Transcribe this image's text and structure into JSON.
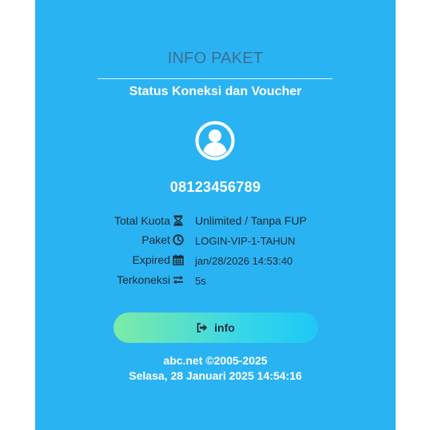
{
  "header": {
    "title": "INFO PAKET",
    "subtitle": "Status Koneksi dan Voucher"
  },
  "user": {
    "avatar_icon": "user-circle-icon",
    "username": "08123456789"
  },
  "details": [
    {
      "label": "Total Kuota",
      "icon": "hourglass-icon",
      "value": "Unlimited / Tanpa FUP"
    },
    {
      "label": "Paket",
      "icon": "clock-icon",
      "value": "LOGIN-VIP-1-TAHUN"
    },
    {
      "label": "Expired",
      "icon": "calendar-icon",
      "value": "jan/28/2026 14:53:40"
    },
    {
      "label": "Terkoneksi",
      "icon": "exchange-icon",
      "value": "5s"
    }
  ],
  "button": {
    "icon": "sign-out-icon",
    "label": "info"
  },
  "footer": {
    "copyright": "abc.net ©2005-2025",
    "datetime": "Selasa, 28 Januari 2025 14:54:16"
  },
  "colors": {
    "panel": "#2ab3f3",
    "title": "#3d6f90",
    "button_gradient_start": "#7deba6",
    "button_gradient_end": "#1ec8f5"
  }
}
